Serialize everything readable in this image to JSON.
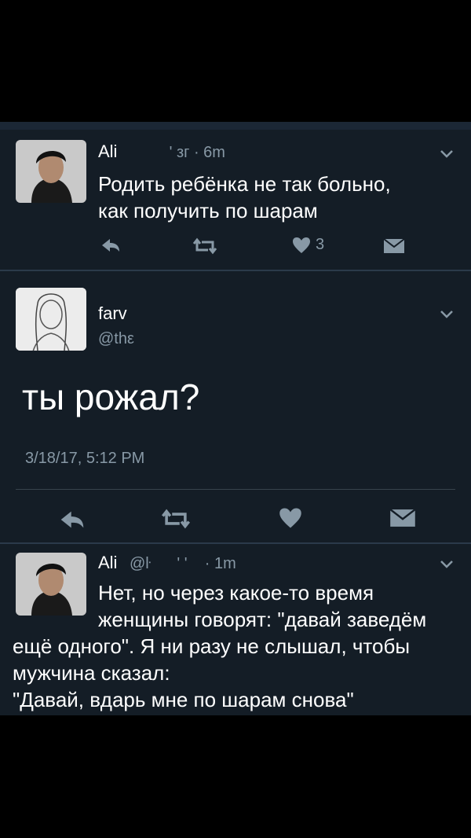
{
  "tweet1": {
    "name": "Ali",
    "meta": "          ' зг · 6m",
    "line1": "Родить ребёнка не так больно,",
    "line2": "как получить по шарам",
    "like_count": "3"
  },
  "tweet2": {
    "name": "farv",
    "handle": "@thε",
    "text": "ты рожал?",
    "date": "3/18/17, 5:12 PM"
  },
  "tweet3": {
    "name": "Ali",
    "meta": "@ŀ      ' '    · 1m",
    "line1": "Нет, но через какое-то время",
    "line2": "женщины говорят: \"давай заведём",
    "line3": "ещё одного\". Я ни разу не слышал, чтобы",
    "line4": "мужчина сказал:",
    "line5": "\"Давай, вдарь мне по шарам снова\""
  },
  "icons": {
    "reply": "reply-icon",
    "retweet": "retweet-icon",
    "like": "heart-icon",
    "dm": "envelope-icon",
    "more": "chevron-down-icon"
  },
  "colors": {
    "background": "#141d26",
    "text": "#ffffff",
    "muted": "#8899a6"
  }
}
